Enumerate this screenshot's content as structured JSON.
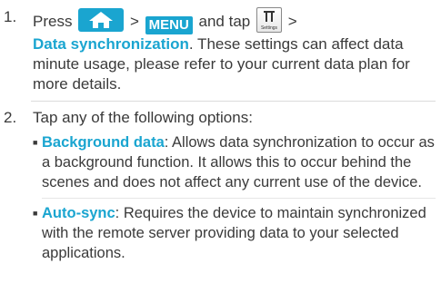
{
  "step1": {
    "number": "1.",
    "press": "Press",
    "gt1": ">",
    "menu": "MENU",
    "and_tap": "and tap",
    "gt2": ">",
    "settings_caption": "Settings",
    "link": "Data synchronization",
    "rest": ". These settings can affect data minute usage, please refer to your current data plan for more details."
  },
  "step2": {
    "number": "2.",
    "text": "Tap any of the following options:",
    "options": [
      {
        "term": "Background data",
        "desc": ": Allows data synchronization to occur as a background function. It allows this to occur behind the scenes and does not affect any current use of the device."
      },
      {
        "term": "Auto-sync",
        "desc": ": Requires the device to maintain synchronized with the remote server providing data to your selected applications."
      }
    ]
  },
  "colors": {
    "accent": "#1aa5d0",
    "text": "#3a3a3a"
  },
  "icons": {
    "home": "home-icon",
    "settings": "settings-icon",
    "bullet": "square-bullet"
  }
}
